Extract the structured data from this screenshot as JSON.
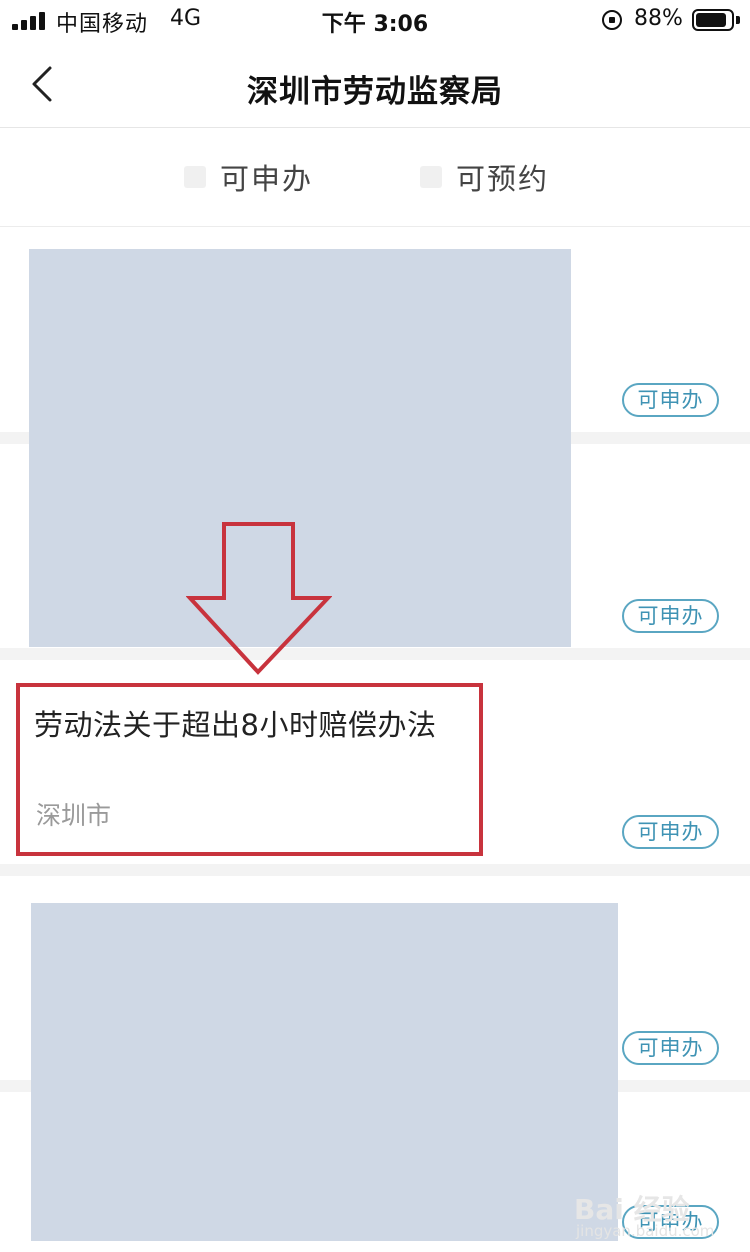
{
  "status_bar": {
    "carrier": "中国移动",
    "network": "4G",
    "time": "下午 3:06",
    "battery": "88%",
    "battery_level": 0.88
  },
  "nav": {
    "title": "深圳市劳动监察局",
    "back_icon": "chevron-left-icon"
  },
  "filters": [
    {
      "label": "可申办"
    },
    {
      "label": "可预约"
    }
  ],
  "items": [
    {
      "title": "",
      "city": "",
      "tag": "可申办"
    },
    {
      "title": "",
      "city": "",
      "tag": "可申办"
    },
    {
      "title": "劳动法关于超出8小时赔偿办法",
      "city": "深圳市",
      "tag": "可申办"
    },
    {
      "title": "",
      "city": "",
      "tag": "可申办"
    },
    {
      "title": "",
      "city": "",
      "tag": "可申办"
    }
  ],
  "annotation": {
    "arrow_color": "#c8333d",
    "box_color": "#c8333d"
  },
  "watermark": {
    "main": "Bai 经验",
    "sub": "jingyan.baidu.com"
  },
  "colors": {
    "tag_border": "#5aa6c2",
    "tag_text": "#3f93b4",
    "mask": "#cfd8e5"
  }
}
